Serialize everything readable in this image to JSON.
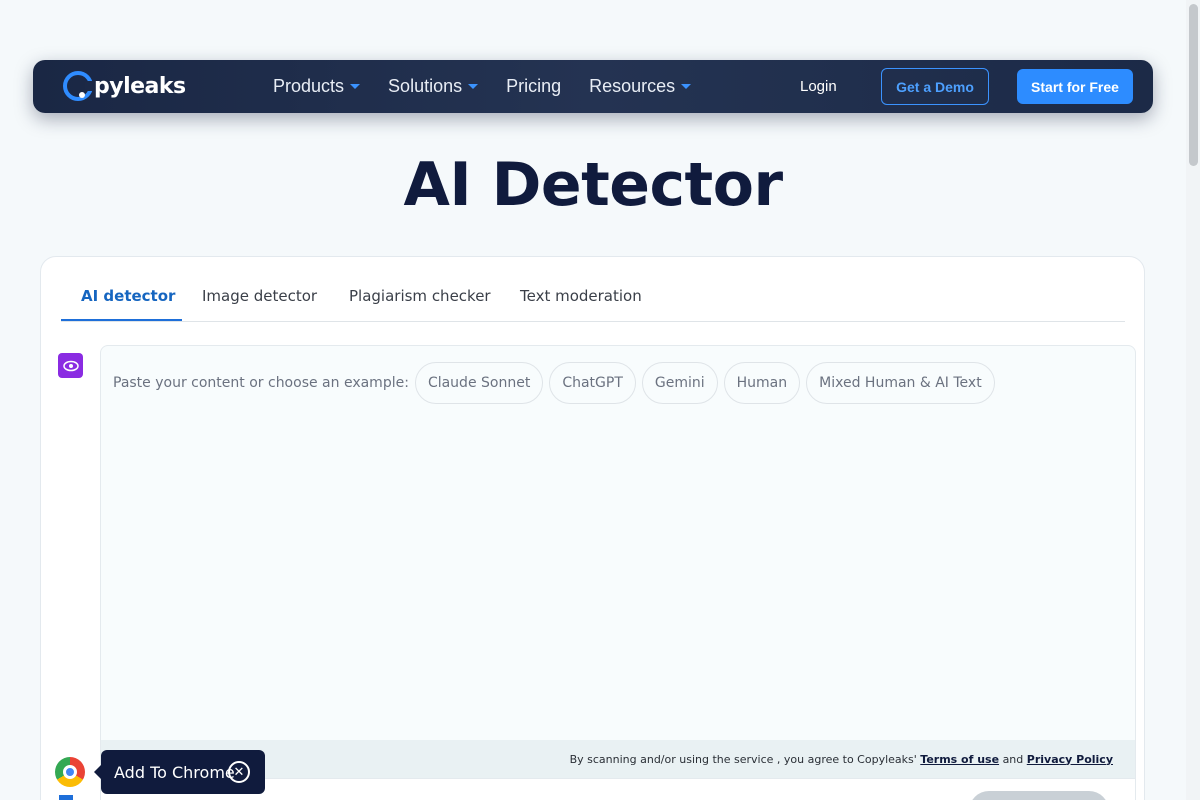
{
  "nav": {
    "logo_text": "pyleaks",
    "links": [
      {
        "label": "Products",
        "has_dropdown": true
      },
      {
        "label": "Solutions",
        "has_dropdown": true
      },
      {
        "label": "Pricing",
        "has_dropdown": false
      },
      {
        "label": "Resources",
        "has_dropdown": true
      }
    ],
    "login_label": "Login",
    "demo_label": "Get a Demo",
    "start_label": "Start for Free"
  },
  "page": {
    "title": "AI Detector"
  },
  "tabs": [
    {
      "label": "AI detector",
      "active": true
    },
    {
      "label": "Image detector",
      "active": false
    },
    {
      "label": "Plagiarism checker",
      "active": false
    },
    {
      "label": "Text moderation",
      "active": false
    }
  ],
  "editor": {
    "prompt": "Paste your content or choose an example:",
    "examples": [
      "Claude Sonnet",
      "ChatGPT",
      "Gemini",
      "Human",
      "Mixed Human & AI Text"
    ]
  },
  "terms": {
    "prefix": "By scanning and/or using the service , you agree to Copyleaks'",
    "terms_link": "Terms of use",
    "middle": "and",
    "privacy_link": "Privacy Policy"
  },
  "chrome_promo": {
    "label": "Add To Chrome",
    "close_glyph": "✕"
  },
  "icons": {
    "eye": "eye-icon",
    "chrome": "chrome-icon",
    "close": "close-icon"
  },
  "colors": {
    "accent": "#2d8cff",
    "nav_bg": "#1a2744",
    "title": "#101b3d",
    "eye_button": "#8a2be2"
  }
}
